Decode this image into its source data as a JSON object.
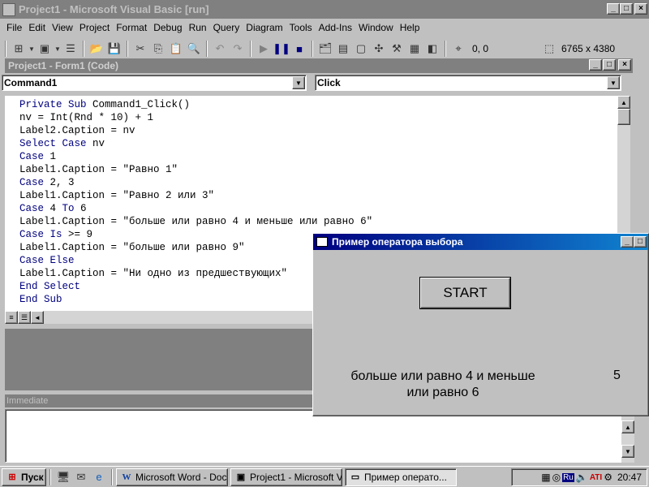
{
  "app": {
    "title": "Project1 - Microsoft Visual Basic [run]"
  },
  "menu": [
    "File",
    "Edit",
    "View",
    "Project",
    "Format",
    "Debug",
    "Run",
    "Query",
    "Diagram",
    "Tools",
    "Add-Ins",
    "Window",
    "Help"
  ],
  "toolbar": {
    "coords": "0, 0",
    "size": "6765 x 4380"
  },
  "code_window": {
    "title": "Project1 - Form1 (Code)",
    "object_combo": "Command1",
    "proc_combo": "Click",
    "lines": [
      [
        {
          "t": "Private Sub ",
          "k": true
        },
        {
          "t": "Command1_Click()",
          "k": false
        }
      ],
      [
        {
          "t": "nv = Int(Rnd * 10) + 1",
          "k": false
        }
      ],
      [
        {
          "t": "Label2.Caption = nv",
          "k": false
        }
      ],
      [
        {
          "t": "Select Case ",
          "k": true
        },
        {
          "t": "nv",
          "k": false
        }
      ],
      [
        {
          "t": "Case ",
          "k": true
        },
        {
          "t": "1",
          "k": false
        }
      ],
      [
        {
          "t": "Label1.Caption = \"Равно 1\"",
          "k": false
        }
      ],
      [
        {
          "t": "Case ",
          "k": true
        },
        {
          "t": "2, 3",
          "k": false
        }
      ],
      [
        {
          "t": "Label1.Caption = \"Равно 2 или 3\"",
          "k": false
        }
      ],
      [
        {
          "t": "Case ",
          "k": true
        },
        {
          "t": "4 ",
          "k": false
        },
        {
          "t": "To ",
          "k": true
        },
        {
          "t": "6",
          "k": false
        }
      ],
      [
        {
          "t": "Label1.Caption = \"больше или равно 4 и меньше или равно 6\"",
          "k": false
        }
      ],
      [
        {
          "t": "Case Is ",
          "k": true
        },
        {
          "t": ">= 9",
          "k": false
        }
      ],
      [
        {
          "t": "Label1.Caption = \"больше или равно 9\"",
          "k": false
        }
      ],
      [
        {
          "t": "Case Else",
          "k": true
        }
      ],
      [
        {
          "t": "Label1.Caption = \"Ни одно из предшествующих\"",
          "k": false
        }
      ],
      [
        {
          "t": "End Select",
          "k": true
        }
      ],
      [
        {
          "t": "End Sub",
          "k": true
        }
      ]
    ]
  },
  "immediate": {
    "title": "Immediate"
  },
  "form": {
    "title": "Пример оператора выбора",
    "button": "START",
    "label1": "больше или равно 4 и меньше или равно 6",
    "label2": "5"
  },
  "taskbar": {
    "start": "Пуск",
    "tasks": [
      "Microsoft Word - Doc...",
      "Project1 - Microsoft Vi...",
      "Пример операто..."
    ],
    "lang": "Ru",
    "clock": "20:47"
  },
  "colors": {
    "title_active_start": "#000080",
    "title_active_end": "#1084d0",
    "keyword": "#000080",
    "face": "#c0c0c0"
  }
}
